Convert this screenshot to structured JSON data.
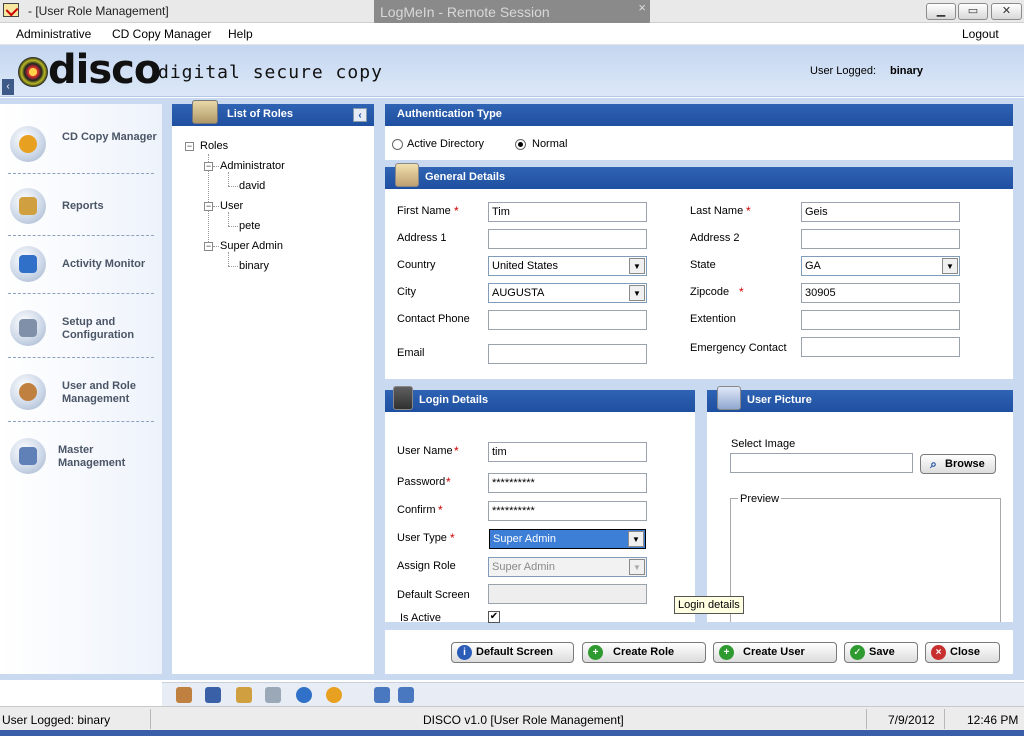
{
  "window": {
    "title": "- [User Role Management]",
    "remote_session": "LogMeIn - Remote Session",
    "remote_close": "×",
    "btn_min": "▁",
    "btn_max": "▭",
    "btn_close": "✕"
  },
  "menu": {
    "items": [
      "Administrative",
      "CD Copy Manager",
      "Help"
    ],
    "logout": "Logout"
  },
  "header": {
    "logo_text": "disco",
    "tagline": "digital secure copy",
    "user_logged_label": "User Logged:",
    "user_logged_value": "binary",
    "collapse": "‹"
  },
  "nav": [
    {
      "label": "CD Copy Manager",
      "icon": "disc-icon",
      "color": "#e8a020"
    },
    {
      "label": "Reports",
      "icon": "notepad-icon",
      "color": "#d0a040"
    },
    {
      "label": "Activity Monitor",
      "icon": "monitor-icon",
      "color": "#3070c8"
    },
    {
      "label": "Setup and Configuration",
      "icon": "drive-icon",
      "color": "#8090a8"
    },
    {
      "label": "User and Role Management",
      "icon": "users-icon",
      "color": "#c08040"
    },
    {
      "label": "Master Management",
      "icon": "master-icon",
      "color": "#6080b8"
    }
  ],
  "roles": {
    "title": "List of Roles",
    "collapse": "‹",
    "root": "Roles",
    "groups": [
      {
        "name": "Administrator",
        "users": [
          "david"
        ]
      },
      {
        "name": "User",
        "users": [
          "pete"
        ]
      },
      {
        "name": "Super Admin",
        "users": [
          "binary"
        ]
      }
    ],
    "expander": "−"
  },
  "auth": {
    "title": "Authentication Type",
    "options": [
      "Active Directory",
      "Normal"
    ],
    "selected": "Normal"
  },
  "general": {
    "title": "General Details",
    "first_name_label": "First Name",
    "first_name": "Tim",
    "last_name_label": "Last Name",
    "last_name": "Geis",
    "address1_label": "Address 1",
    "address1": "",
    "address2_label": "Address 2",
    "address2": "",
    "country_label": "Country",
    "country": "United States",
    "state_label": "State",
    "state": "GA",
    "city_label": "City",
    "city": "AUGUSTA",
    "zipcode_label": "Zipcode",
    "zipcode": "30905",
    "contact_label": "Contact Phone",
    "contact": "",
    "extention_label": "Extention",
    "extention": "",
    "email_label": "Email",
    "email": "",
    "emergency_label": "Emergency Contact",
    "emergency": "",
    "required_mark": "*"
  },
  "login": {
    "title": "Login Details",
    "username_label": "User Name",
    "username": "tim",
    "password_label": "Password",
    "password": "**********",
    "confirm_label": "Confirm",
    "confirm": "**********",
    "usertype_label": "User Type",
    "usertype": "Super Admin",
    "assignrole_label": "Assign Role",
    "assignrole": "Super Admin",
    "defaultscreen_label": "Default Screen",
    "defaultscreen": "",
    "isactive_label": "Is Active",
    "isactive_check": "✔"
  },
  "picture": {
    "title": "User Picture",
    "select_label": "Select Image",
    "select_value": "",
    "browse": "Browse",
    "preview": "Preview"
  },
  "tooltip": "Login details",
  "buttons": {
    "default_screen": "Default Screen",
    "create_role": "Create Role",
    "create_user": "Create User",
    "save": "Save",
    "close": "Close"
  },
  "status": {
    "user": "User Logged: binary",
    "app": "DISCO v1.0 [User Role Management]",
    "date": "7/9/2012",
    "time": "12:46 PM"
  },
  "arrow": "▼",
  "colors": {
    "panel_header": "#1f4fa0",
    "background": "#c8d9f0",
    "required": "#d00000"
  }
}
